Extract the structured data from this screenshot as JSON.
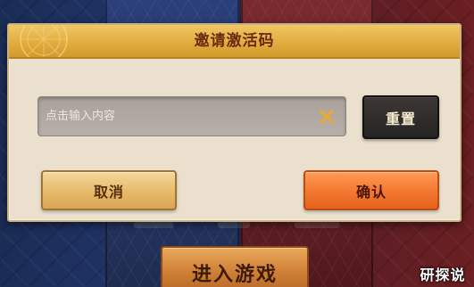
{
  "dialog": {
    "title": "邀请激活码",
    "input": {
      "value": "",
      "placeholder": "点击输入内容"
    },
    "reset_label": "重置",
    "cancel_label": "取消",
    "confirm_label": "确认"
  },
  "background": {
    "enter_game_label": "进入游戏"
  },
  "watermark": {
    "text": "研探说"
  },
  "colors": {
    "header": "#e3ac3e",
    "dialog_bg": "#ebe0cd",
    "confirm": "#f3772f",
    "cancel": "#e6ba6a",
    "reset": "#2f2c29",
    "clear_icon": "#e9a83a"
  },
  "icons": {
    "clear": "close-icon"
  }
}
